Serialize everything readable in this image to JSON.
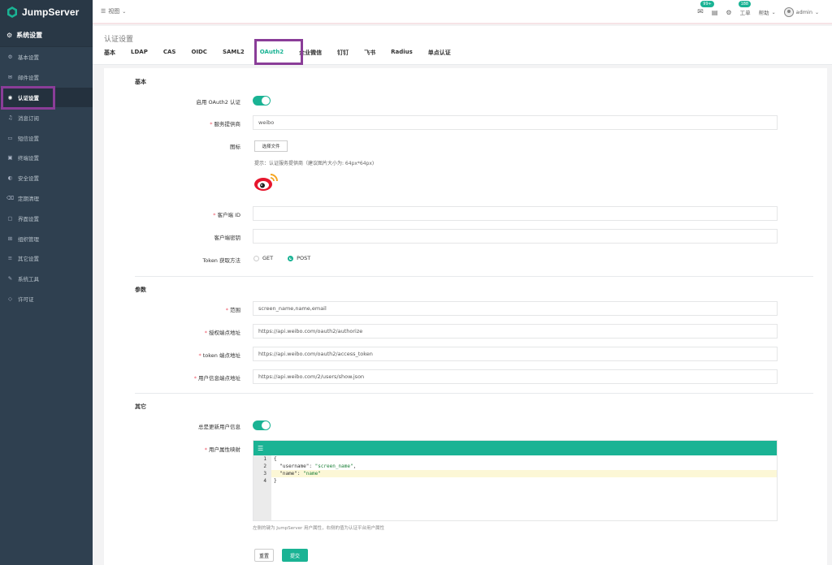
{
  "brand": {
    "name": "JumpServer"
  },
  "sidebar": {
    "header": "系统设置",
    "items": [
      {
        "label": "基本设置",
        "icon": "gear-icon"
      },
      {
        "label": "邮件设置",
        "icon": "envelope-icon"
      },
      {
        "label": "认证设置",
        "icon": "user-circle-icon",
        "active": true
      },
      {
        "label": "消息订阅",
        "icon": "bell-icon"
      },
      {
        "label": "短信设置",
        "icon": "message-icon"
      },
      {
        "label": "终端设置",
        "icon": "terminal-icon"
      },
      {
        "label": "安全设置",
        "icon": "shield-icon"
      },
      {
        "label": "定期清理",
        "icon": "trash-icon"
      },
      {
        "label": "界面设置",
        "icon": "display-icon"
      },
      {
        "label": "组织管理",
        "icon": "sitemap-icon"
      },
      {
        "label": "其它设置",
        "icon": "bars-icon"
      },
      {
        "label": "系统工具",
        "icon": "wrench-icon"
      },
      {
        "label": "许可证",
        "icon": "diamond-icon"
      }
    ]
  },
  "topbar": {
    "view_label": "视图",
    "mail_badge": "99+",
    "tickets_label": "工单",
    "tickets_badge": "188",
    "help_label": "帮助",
    "user_label": "admin"
  },
  "page": {
    "title": "认证设置",
    "tabs": [
      "基本",
      "LDAP",
      "CAS",
      "OIDC",
      "SAML2",
      "OAuth2",
      "企业微信",
      "钉钉",
      "飞书",
      "Radius",
      "单点认证"
    ],
    "active_tab": "OAuth2"
  },
  "form": {
    "section_basic": "基本",
    "enable_label": "启用 OAuth2 认证",
    "provider_label": "服务提供商",
    "provider_value": "weibo",
    "icon_label": "图标",
    "file_button": "选择文件",
    "icon_hint": "提示：认证服务提供商（建议图片大小为: 64px*64px)",
    "client_id_label": "客户端 ID",
    "client_id_value": "",
    "client_secret_label": "客户端密钥",
    "client_secret_value": "",
    "token_method_label": "Token 获取方法",
    "token_method_options": [
      "GET",
      "POST"
    ],
    "token_method_selected": "POST",
    "section_params": "参数",
    "scope_label": "范围",
    "scope_value": "screen_name,name,email",
    "auth_endpoint_label": "授权端点地址",
    "auth_endpoint_value": "https://api.weibo.com/oauth2/authorize",
    "token_endpoint_label": "token 端点地址",
    "token_endpoint_value": "https://api.weibo.com/oauth2/access_token",
    "userinfo_endpoint_label": "用户信息端点地址",
    "userinfo_endpoint_value": "https://api.weibo.com/2/users/show.json",
    "section_other": "其它",
    "always_update_label": "总是更新用户信息",
    "attr_map_label": "用户属性映射",
    "code_lines": [
      {
        "num": "1",
        "text": "{"
      },
      {
        "num": "2",
        "key": "\"username\"",
        "val": "\"screen_name\"",
        "tail": ","
      },
      {
        "num": "3",
        "key": "\"name\"",
        "val": "\"name\"",
        "tail": ""
      },
      {
        "num": "4",
        "text": "}"
      }
    ],
    "attr_map_help": "左侧的键为 JumpServer 用户属性，右侧的值为认证平台用户属性",
    "reset_button": "重置",
    "submit_button": "提交"
  },
  "colors": {
    "accent": "#1ab394",
    "sidebar": "#2f4050",
    "highlight": "#8a3d98"
  }
}
